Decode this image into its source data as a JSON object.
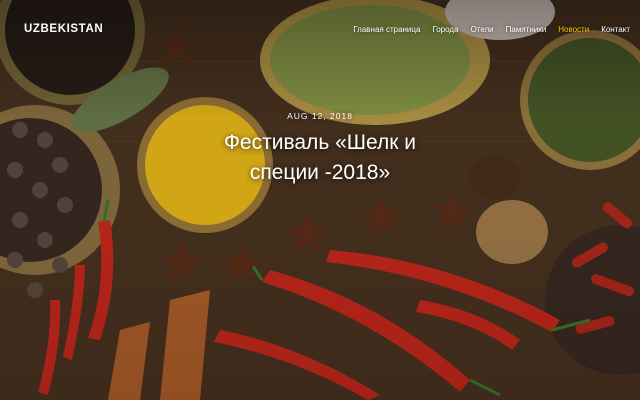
{
  "brand": {
    "name": "UZBEKISTAN"
  },
  "nav": {
    "items": [
      {
        "label": "Главная страница",
        "active": false
      },
      {
        "label": "Города",
        "active": false
      },
      {
        "label": "Отели",
        "active": false
      },
      {
        "label": "Памятники",
        "active": false
      },
      {
        "label": "Новости",
        "active": true
      },
      {
        "label": "Контакт",
        "active": false
      }
    ],
    "active_color": "#f5c400"
  },
  "post": {
    "date": "AUG 12, 2018",
    "title": "Фестиваль «Шелк и специи -2018»"
  },
  "hero": {
    "image_subject": "spices-still-life"
  }
}
